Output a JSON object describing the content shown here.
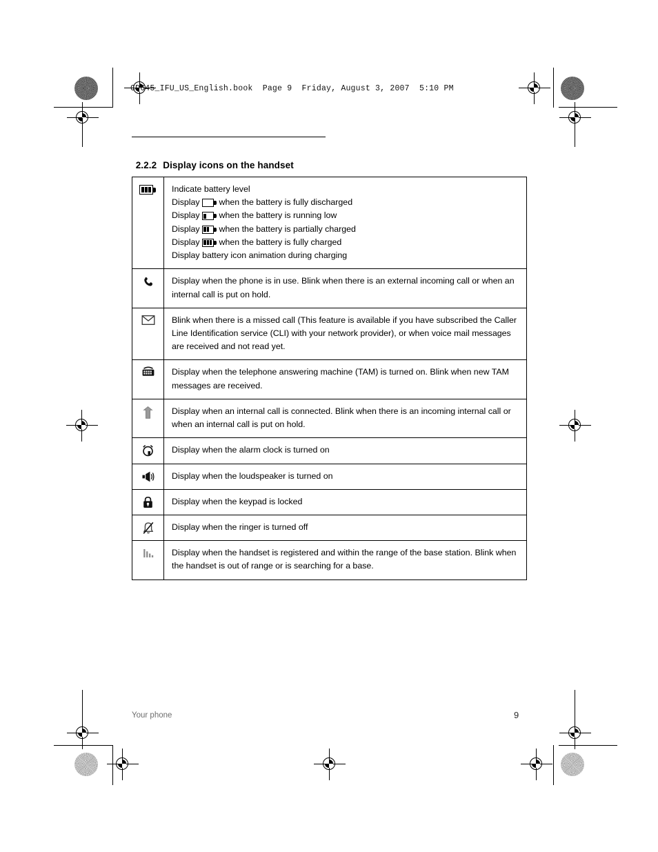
{
  "page": {
    "file_header": "CD645_IFU_US_English.book  Page 9  Friday, August 3, 2007  5:10 PM",
    "section_number": "2.2.2",
    "section_title": "Display icons on the handset",
    "footer_left": "Your phone",
    "footer_page_number": "9"
  },
  "table": {
    "rows": [
      {
        "icon": "battery-icon",
        "lines": [
          {
            "type": "text",
            "text": "Indicate battery level"
          },
          {
            "type": "battery",
            "prefix": "Display",
            "level": 0,
            "suffix": "when the battery is fully discharged"
          },
          {
            "type": "battery",
            "prefix": "Display",
            "level": 1,
            "suffix": "when the battery is running low"
          },
          {
            "type": "battery",
            "prefix": "Display",
            "level": 2,
            "suffix": "when the battery is partially charged"
          },
          {
            "type": "battery",
            "prefix": "Display",
            "level": 3,
            "suffix": "when the battery is fully charged"
          },
          {
            "type": "text",
            "text": "Display battery icon animation during charging"
          }
        ]
      },
      {
        "icon": "phone-handset-icon",
        "text": "Display when the phone is in use. Blink when there is an external incoming call or when an internal call is put on hold."
      },
      {
        "icon": "envelope-icon",
        "text": "Blink when there is a missed call (This feature is available if you have subscribed the Caller Line Identification service (CLI) with your network provider), or when voice mail messages are received and not read yet."
      },
      {
        "icon": "answering-machine-icon",
        "text": "Display when the telephone answering machine (TAM) is turned on.  Blink when new TAM messages are received."
      },
      {
        "icon": "internal-call-icon",
        "text": "Display when an internal call is connected. Blink when there is an incoming internal call or when an internal call is put on hold."
      },
      {
        "icon": "alarm-clock-icon",
        "text": "Display when the alarm clock is turned on"
      },
      {
        "icon": "loudspeaker-icon",
        "text": "Display when the loudspeaker is turned on"
      },
      {
        "icon": "padlock-icon",
        "text": "Display when the keypad is locked"
      },
      {
        "icon": "ringer-off-icon",
        "text": "Display when the ringer is turned off"
      },
      {
        "icon": "signal-strength-icon",
        "text": "Display when the handset is registered and within the range of the base station.  Blink when the handset is out of range or is searching for a base."
      }
    ]
  }
}
